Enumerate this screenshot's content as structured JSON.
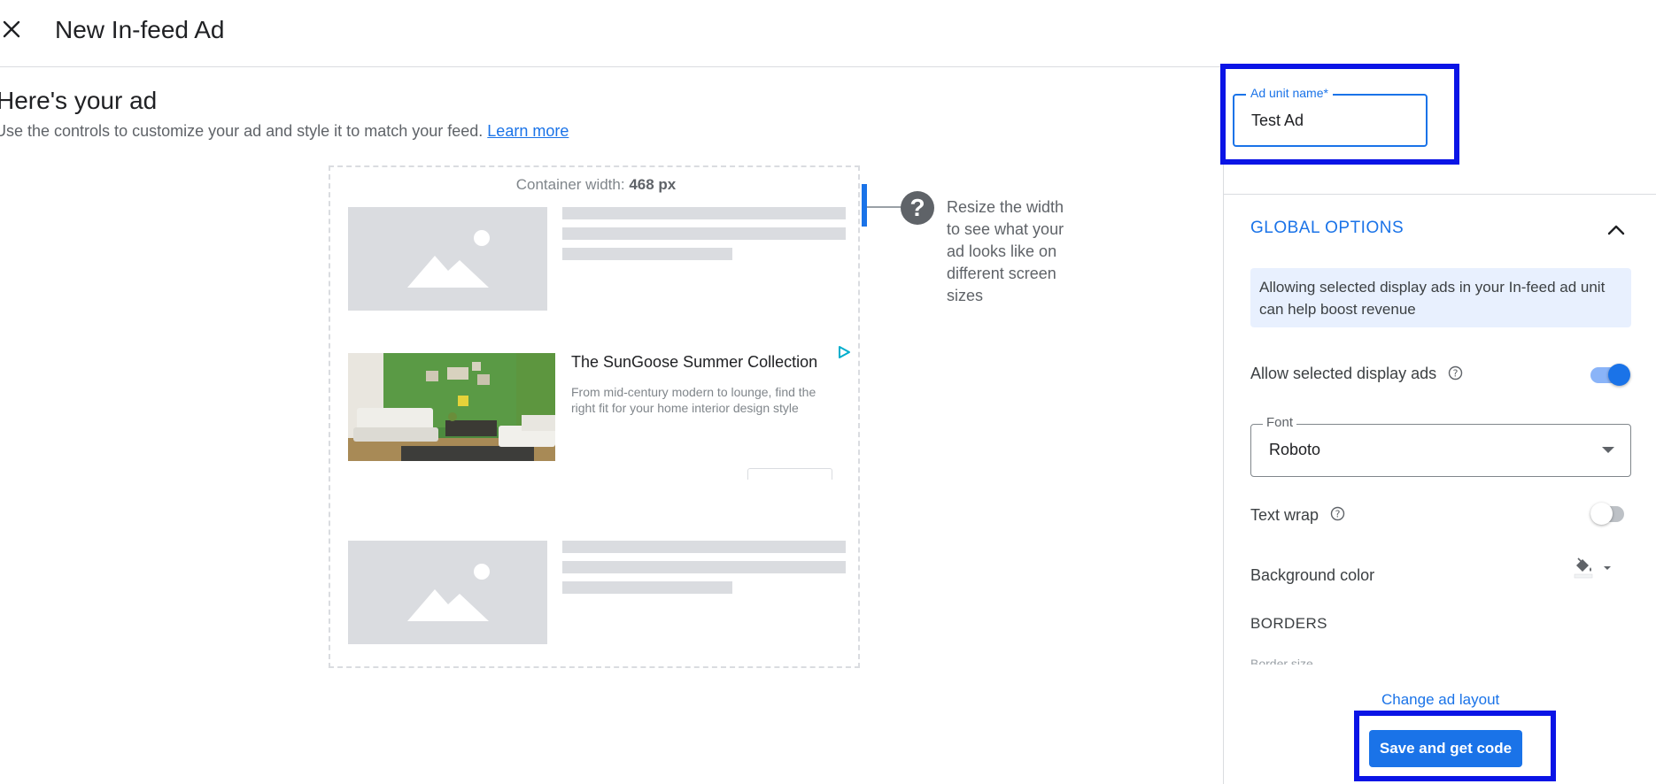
{
  "header": {
    "title": "New In-feed Ad",
    "close_icon": "close-icon"
  },
  "main": {
    "heading": "Here's your ad",
    "subtext": "Use the controls to customize your ad and style it to match your feed.",
    "learn_more": "Learn more",
    "preview": {
      "container_width_label": "Container width:",
      "container_width_value": "468 px",
      "ad": {
        "title": "The SunGoose Summer Collection",
        "description": "From mid-century modern to lounge, find the right fit for your home interior design style",
        "ad_choices_icon": "ad-choices-icon"
      },
      "resize_hint": "Resize the width to see what your ad looks like on different screen sizes",
      "help_icon": "help-circle-icon"
    }
  },
  "panel": {
    "ad_unit_name": {
      "label": "Ad unit name*",
      "value": "Test Ad"
    },
    "global_options": {
      "title": "GLOBAL OPTIONS",
      "info": "Allowing selected display ads in your In-feed ad unit can help boost revenue",
      "allow_display_ads": {
        "label": "Allow selected display ads",
        "enabled": true
      },
      "font": {
        "label": "Font",
        "value": "Roboto"
      },
      "text_wrap": {
        "label": "Text wrap",
        "enabled": false
      },
      "background_color": {
        "label": "Background color",
        "icon": "paint-bucket-icon"
      },
      "borders": {
        "label": "BORDERS",
        "border_size_label": "Border size"
      }
    },
    "change_layout": "Change ad layout",
    "save_button": "Save and get code"
  },
  "colors": {
    "accent": "#1a73e8",
    "highlight_box": "#0a14e6",
    "placeholder": "#dadce0",
    "info_bg": "#e8f0fe"
  }
}
